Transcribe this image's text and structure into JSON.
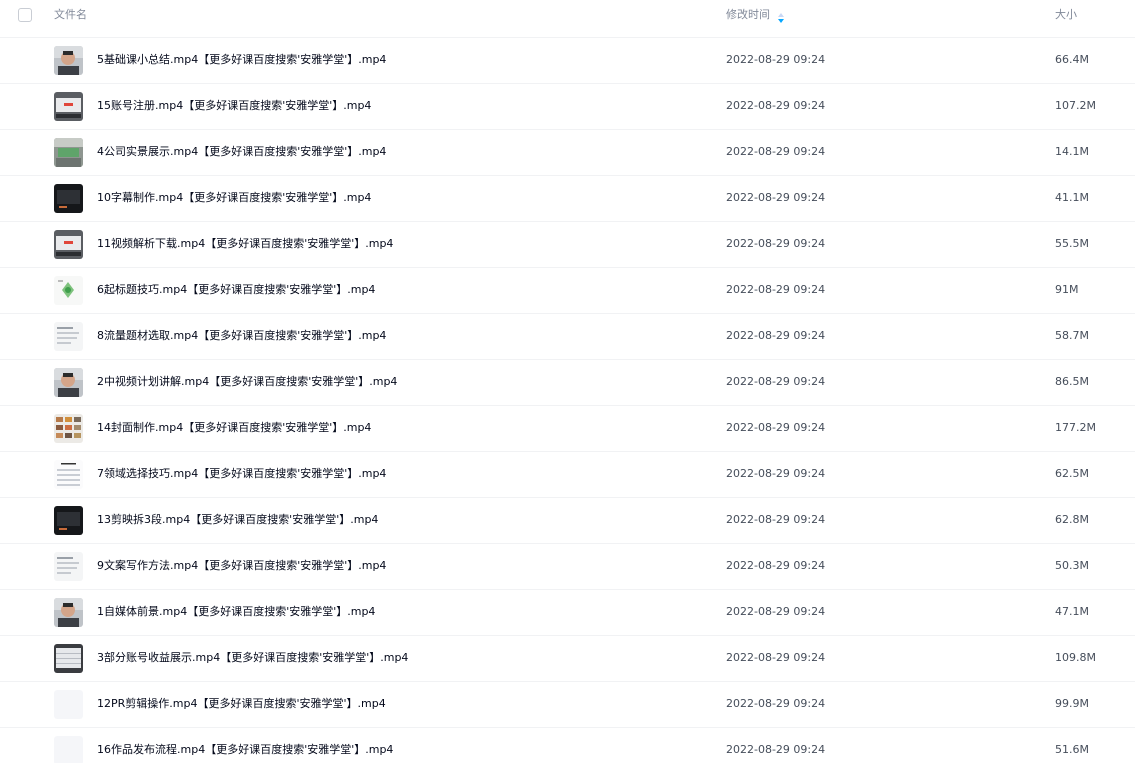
{
  "header": {
    "name_label": "文件名",
    "time_label": "修改时间",
    "size_label": "大小"
  },
  "files": [
    {
      "name": "5基础课小总结.mp4【更多好课百度搜索'安雅学堂'】.mp4",
      "modified": "2022-08-29 09:24",
      "size": "66.4M",
      "thumb_icon": "video-thumbnail-person"
    },
    {
      "name": "15账号注册.mp4【更多好课百度搜索'安雅学堂'】.mp4",
      "modified": "2022-08-29 09:24",
      "size": "107.2M",
      "thumb_icon": "video-thumbnail-screen"
    },
    {
      "name": "4公司实景展示.mp4【更多好课百度搜索'安雅学堂'】.mp4",
      "modified": "2022-08-29 09:24",
      "size": "14.1M",
      "thumb_icon": "video-thumbnail-office"
    },
    {
      "name": "10字幕制作.mp4【更多好课百度搜索'安雅学堂'】.mp4",
      "modified": "2022-08-29 09:24",
      "size": "41.1M",
      "thumb_icon": "video-thumbnail-dark"
    },
    {
      "name": "11视频解析下载.mp4【更多好课百度搜索'安雅学堂'】.mp4",
      "modified": "2022-08-29 09:24",
      "size": "55.5M",
      "thumb_icon": "video-thumbnail-screen"
    },
    {
      "name": "6起标题技巧.mp4【更多好课百度搜索'安雅学堂'】.mp4",
      "modified": "2022-08-29 09:24",
      "size": "91M",
      "thumb_icon": "video-thumbnail-diagram"
    },
    {
      "name": "8流量题材选取.mp4【更多好课百度搜索'安雅学堂'】.mp4",
      "modified": "2022-08-29 09:24",
      "size": "58.7M",
      "thumb_icon": "video-thumbnail-doc"
    },
    {
      "name": "2中视频计划讲解.mp4【更多好课百度搜索'安雅学堂'】.mp4",
      "modified": "2022-08-29 09:24",
      "size": "86.5M",
      "thumb_icon": "video-thumbnail-person"
    },
    {
      "name": "14封面制作.mp4【更多好课百度搜索'安雅学堂'】.mp4",
      "modified": "2022-08-29 09:24",
      "size": "177.2M",
      "thumb_icon": "video-thumbnail-grid"
    },
    {
      "name": "7领域选择技巧.mp4【更多好课百度搜索'安雅学堂'】.mp4",
      "modified": "2022-08-29 09:24",
      "size": "62.5M",
      "thumb_icon": "video-thumbnail-list"
    },
    {
      "name": "13剪映拆3段.mp4【更多好课百度搜索'安雅学堂'】.mp4",
      "modified": "2022-08-29 09:24",
      "size": "62.8M",
      "thumb_icon": "video-thumbnail-dark"
    },
    {
      "name": "9文案写作方法.mp4【更多好课百度搜索'安雅学堂'】.mp4",
      "modified": "2022-08-29 09:24",
      "size": "50.3M",
      "thumb_icon": "video-thumbnail-doc"
    },
    {
      "name": "1自媒体前景.mp4【更多好课百度搜索'安雅学堂'】.mp4",
      "modified": "2022-08-29 09:24",
      "size": "47.1M",
      "thumb_icon": "video-thumbnail-person"
    },
    {
      "name": "3部分账号收益展示.mp4【更多好课百度搜索'安雅学堂'】.mp4",
      "modified": "2022-08-29 09:24",
      "size": "109.8M",
      "thumb_icon": "video-thumbnail-table"
    },
    {
      "name": "12PR剪辑操作.mp4【更多好课百度搜索'安雅学堂'】.mp4",
      "modified": "2022-08-29 09:24",
      "size": "99.9M",
      "thumb_icon": "video-placeholder"
    },
    {
      "name": "16作品发布流程.mp4【更多好课百度搜索'安雅学堂'】.mp4",
      "modified": "2022-08-29 09:24",
      "size": "51.6M",
      "thumb_icon": "video-placeholder"
    }
  ],
  "colors": {
    "accent": "#06a7ff",
    "text_primary": "#03081a",
    "text_secondary": "#454d5a",
    "header_text": "#818999",
    "row_divider": "#f1f2f4"
  }
}
